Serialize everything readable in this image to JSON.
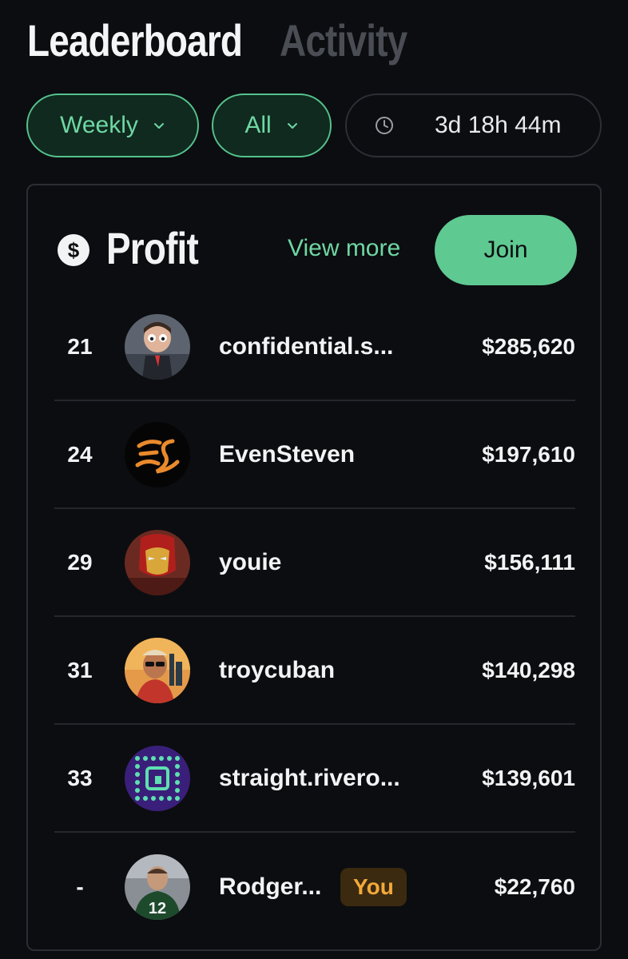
{
  "tabs": [
    {
      "label": "Leaderboard",
      "active": true
    },
    {
      "label": "Activity",
      "active": false
    }
  ],
  "filters": {
    "period": "Weekly",
    "scope": "All",
    "countdown": "3d 18h 44m"
  },
  "card": {
    "title": "Profit",
    "icon": "dollar-icon",
    "view_more": "View more",
    "join": "Join"
  },
  "rows": [
    {
      "rank": "21",
      "name": "confidential.s...",
      "amount": "$285,620",
      "avatar": "avatar-character"
    },
    {
      "rank": "24",
      "name": "EvenSteven",
      "amount": "$197,610",
      "avatar": "avatar-es-logo"
    },
    {
      "rank": "29",
      "name": "youie",
      "amount": "$156,111",
      "avatar": "avatar-armor"
    },
    {
      "rank": "31",
      "name": "troycuban",
      "amount": "$140,298",
      "avatar": "avatar-person-sunglasses"
    },
    {
      "rank": "33",
      "name": "straight.rivero...",
      "amount": "$139,601",
      "avatar": "avatar-dot-pattern"
    },
    {
      "rank": "-",
      "name": "Rodger...",
      "amount": "$22,760",
      "avatar": "avatar-football-player",
      "badge": "You"
    }
  ],
  "colors": {
    "accent": "#5fc992",
    "accent_text": "#6fd7a3",
    "background": "#0c0d10",
    "you_badge_text": "#f3a93a"
  }
}
